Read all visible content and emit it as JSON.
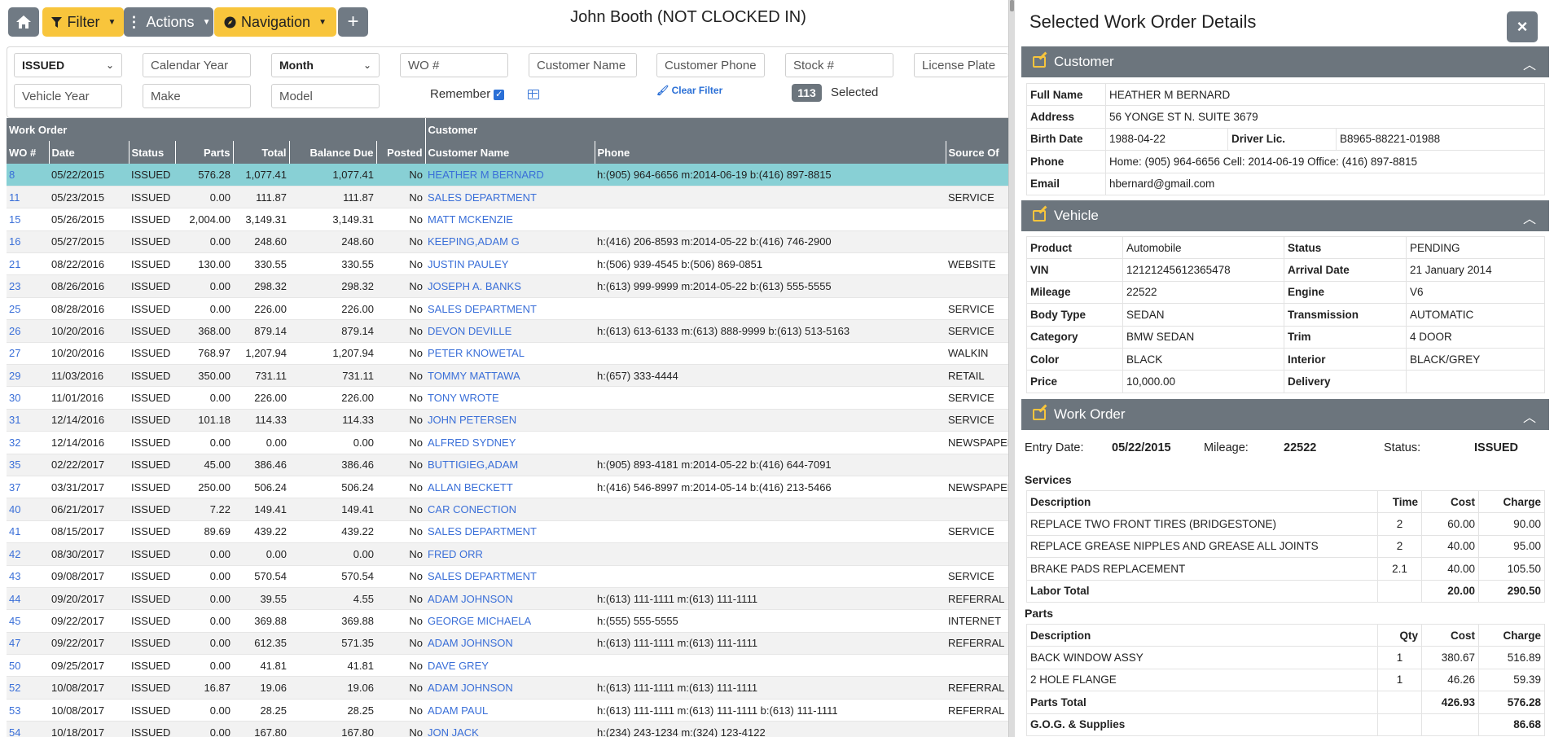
{
  "topbar": {
    "filter_label": "Filter",
    "actions_label": "Actions",
    "navigation_label": "Navigation",
    "user_title": "John Booth (NOT CLOCKED IN)"
  },
  "filters": {
    "status_selected": "ISSUED",
    "calendar_year_placeholder": "Calendar Year",
    "month_selected": "Month",
    "wo_placeholder": "WO #",
    "customer_name_placeholder": "Customer Name",
    "customer_phone_placeholder": "Customer Phone",
    "stock_placeholder": "Stock #",
    "license_plate_placeholder": "License Plate",
    "vehicle_year_placeholder": "Vehicle Year",
    "make_placeholder": "Make",
    "model_placeholder": "Model",
    "remember_label": "Remember",
    "remember_checked": true,
    "clear_filter_label": "Clear Filter",
    "count": "113",
    "selected_label": "Selected"
  },
  "table": {
    "group_headers": {
      "work_order": "Work Order",
      "customer": "Customer"
    },
    "columns": [
      "WO #",
      "Date",
      "Status",
      "Parts",
      "Total",
      "Balance Due",
      "Posted",
      "Customer Name",
      "Phone",
      "Source Of"
    ],
    "rows": [
      {
        "wo": "8",
        "date": "05/22/2015",
        "status": "ISSUED",
        "parts": "576.28",
        "total": "1,077.41",
        "balance": "1,077.41",
        "posted": "No",
        "customer": "HEATHER M BERNARD",
        "phone": "h:(905) 964-6656 m:2014-06-19 b:(416) 897-8815",
        "source": ""
      },
      {
        "wo": "11",
        "date": "05/23/2015",
        "status": "ISSUED",
        "parts": "0.00",
        "total": "111.87",
        "balance": "111.87",
        "posted": "No",
        "customer": "SALES DEPARTMENT",
        "phone": "",
        "source": "SERVICE"
      },
      {
        "wo": "15",
        "date": "05/26/2015",
        "status": "ISSUED",
        "parts": "2,004.00",
        "total": "3,149.31",
        "balance": "3,149.31",
        "posted": "No",
        "customer": "MATT MCKENZIE",
        "phone": "",
        "source": ""
      },
      {
        "wo": "16",
        "date": "05/27/2015",
        "status": "ISSUED",
        "parts": "0.00",
        "total": "248.60",
        "balance": "248.60",
        "posted": "No",
        "customer": "KEEPING,ADAM G",
        "phone": "h:(416) 206-8593 m:2014-05-22 b:(416) 746-2900",
        "source": ""
      },
      {
        "wo": "21",
        "date": "08/22/2016",
        "status": "ISSUED",
        "parts": "130.00",
        "total": "330.55",
        "balance": "330.55",
        "posted": "No",
        "customer": "JUSTIN PAULEY",
        "phone": "h:(506) 939-4545 b:(506) 869-0851",
        "source": "WEBSITE"
      },
      {
        "wo": "23",
        "date": "08/26/2016",
        "status": "ISSUED",
        "parts": "0.00",
        "total": "298.32",
        "balance": "298.32",
        "posted": "No",
        "customer": "JOSEPH A. BANKS",
        "phone": "h:(613) 999-9999 m:2014-05-22 b:(613) 555-5555",
        "source": ""
      },
      {
        "wo": "25",
        "date": "08/28/2016",
        "status": "ISSUED",
        "parts": "0.00",
        "total": "226.00",
        "balance": "226.00",
        "posted": "No",
        "customer": "SALES DEPARTMENT",
        "phone": "",
        "source": "SERVICE"
      },
      {
        "wo": "26",
        "date": "10/20/2016",
        "status": "ISSUED",
        "parts": "368.00",
        "total": "879.14",
        "balance": "879.14",
        "posted": "No",
        "customer": "DEVON DEVILLE",
        "phone": "h:(613) 613-6133 m:(613) 888-9999 b:(613) 513-5163",
        "source": "SERVICE"
      },
      {
        "wo": "27",
        "date": "10/20/2016",
        "status": "ISSUED",
        "parts": "768.97",
        "total": "1,207.94",
        "balance": "1,207.94",
        "posted": "No",
        "customer": "PETER KNOWETAL",
        "phone": "",
        "source": "WALKIN"
      },
      {
        "wo": "29",
        "date": "11/03/2016",
        "status": "ISSUED",
        "parts": "350.00",
        "total": "731.11",
        "balance": "731.11",
        "posted": "No",
        "customer": "TOMMY MATTAWA",
        "phone": "h:(657) 333-4444",
        "source": "RETAIL"
      },
      {
        "wo": "30",
        "date": "11/01/2016",
        "status": "ISSUED",
        "parts": "0.00",
        "total": "226.00",
        "balance": "226.00",
        "posted": "No",
        "customer": "TONY WROTE",
        "phone": "",
        "source": "SERVICE"
      },
      {
        "wo": "31",
        "date": "12/14/2016",
        "status": "ISSUED",
        "parts": "101.18",
        "total": "114.33",
        "balance": "114.33",
        "posted": "No",
        "customer": "JOHN PETERSEN",
        "phone": "",
        "source": "SERVICE"
      },
      {
        "wo": "32",
        "date": "12/14/2016",
        "status": "ISSUED",
        "parts": "0.00",
        "total": "0.00",
        "balance": "0.00",
        "posted": "No",
        "customer": "ALFRED SYDNEY",
        "phone": "",
        "source": "NEWSPAPER"
      },
      {
        "wo": "35",
        "date": "02/22/2017",
        "status": "ISSUED",
        "parts": "45.00",
        "total": "386.46",
        "balance": "386.46",
        "posted": "No",
        "customer": "BUTTIGIEG,ADAM",
        "phone": "h:(905) 893-4181 m:2014-05-22 b:(416) 644-7091",
        "source": ""
      },
      {
        "wo": "37",
        "date": "03/31/2017",
        "status": "ISSUED",
        "parts": "250.00",
        "total": "506.24",
        "balance": "506.24",
        "posted": "No",
        "customer": "ALLAN BECKETT",
        "phone": "h:(416) 546-8997 m:2014-05-14 b:(416) 213-5466",
        "source": "NEWSPAPER"
      },
      {
        "wo": "40",
        "date": "06/21/2017",
        "status": "ISSUED",
        "parts": "7.22",
        "total": "149.41",
        "balance": "149.41",
        "posted": "No",
        "customer": "CAR CONECTION",
        "phone": "",
        "source": ""
      },
      {
        "wo": "41",
        "date": "08/15/2017",
        "status": "ISSUED",
        "parts": "89.69",
        "total": "439.22",
        "balance": "439.22",
        "posted": "No",
        "customer": "SALES DEPARTMENT",
        "phone": "",
        "source": "SERVICE"
      },
      {
        "wo": "42",
        "date": "08/30/2017",
        "status": "ISSUED",
        "parts": "0.00",
        "total": "0.00",
        "balance": "0.00",
        "posted": "No",
        "customer": "FRED ORR",
        "phone": "",
        "source": ""
      },
      {
        "wo": "43",
        "date": "09/08/2017",
        "status": "ISSUED",
        "parts": "0.00",
        "total": "570.54",
        "balance": "570.54",
        "posted": "No",
        "customer": "SALES DEPARTMENT",
        "phone": "",
        "source": "SERVICE"
      },
      {
        "wo": "44",
        "date": "09/20/2017",
        "status": "ISSUED",
        "parts": "0.00",
        "total": "39.55",
        "balance": "4.55",
        "posted": "No",
        "customer": "ADAM JOHNSON",
        "phone": "h:(613) 111-1111 m:(613) 111-1111",
        "source": "REFERRAL"
      },
      {
        "wo": "45",
        "date": "09/22/2017",
        "status": "ISSUED",
        "parts": "0.00",
        "total": "369.88",
        "balance": "369.88",
        "posted": "No",
        "customer": "GEORGE MICHAELA",
        "phone": "h:(555) 555-5555",
        "source": "INTERNET"
      },
      {
        "wo": "47",
        "date": "09/22/2017",
        "status": "ISSUED",
        "parts": "0.00",
        "total": "612.35",
        "balance": "571.35",
        "posted": "No",
        "customer": "ADAM JOHNSON",
        "phone": "h:(613) 111-1111 m:(613) 111-1111",
        "source": "REFERRAL"
      },
      {
        "wo": "50",
        "date": "09/25/2017",
        "status": "ISSUED",
        "parts": "0.00",
        "total": "41.81",
        "balance": "41.81",
        "posted": "No",
        "customer": "DAVE GREY",
        "phone": "",
        "source": ""
      },
      {
        "wo": "52",
        "date": "10/08/2017",
        "status": "ISSUED",
        "parts": "16.87",
        "total": "19.06",
        "balance": "19.06",
        "posted": "No",
        "customer": "ADAM JOHNSON",
        "phone": "h:(613) 111-1111 m:(613) 111-1111",
        "source": "REFERRAL"
      },
      {
        "wo": "53",
        "date": "10/08/2017",
        "status": "ISSUED",
        "parts": "0.00",
        "total": "28.25",
        "balance": "28.25",
        "posted": "No",
        "customer": "ADAM PAUL",
        "phone": "h:(613) 111-1111 m:(613) 111-1111 b:(613) 111-1111",
        "source": "REFERRAL"
      },
      {
        "wo": "54",
        "date": "10/18/2017",
        "status": "ISSUED",
        "parts": "0.00",
        "total": "167.80",
        "balance": "167.80",
        "posted": "No",
        "customer": "JON JACK",
        "phone": "h:(234) 243-1234 m:(324) 123-4122",
        "source": ""
      }
    ]
  },
  "details": {
    "title": "Selected Work Order Details",
    "close_label": "×",
    "customer": {
      "header": "Customer",
      "full_name_label": "Full Name",
      "full_name": "HEATHER M BERNARD",
      "address_label": "Address",
      "address": "56 YONGE ST N. SUITE 3679",
      "birth_label": "Birth Date",
      "birth": "1988-04-22",
      "dl_label": "Driver Lic.",
      "dl": "B8965-88221-01988",
      "phone_label": "Phone",
      "phone": "Home: (905) 964-6656 Cell: 2014-06-19 Office: (416) 897-8815",
      "email_label": "Email",
      "email": "hbernard@gmail.com"
    },
    "vehicle": {
      "header": "Vehicle",
      "rows": [
        {
          "k1": "Product",
          "v1": "Automobile",
          "k2": "Status",
          "v2": "PENDING"
        },
        {
          "k1": "VIN",
          "v1": "12121245612365478",
          "k2": "Arrival Date",
          "v2": "21 January 2014"
        },
        {
          "k1": "Mileage",
          "v1": "22522",
          "k2": "Engine",
          "v2": "V6"
        },
        {
          "k1": "Body Type",
          "v1": "SEDAN",
          "k2": "Transmission",
          "v2": "AUTOMATIC"
        },
        {
          "k1": "Category",
          "v1": "BMW SEDAN",
          "k2": "Trim",
          "v2": "4 DOOR"
        },
        {
          "k1": "Color",
          "v1": "BLACK",
          "k2": "Interior",
          "v2": "BLACK/GREY"
        },
        {
          "k1": "Price",
          "v1": "10,000.00",
          "k2": "Delivery",
          "v2": ""
        }
      ]
    },
    "work_order": {
      "header": "Work Order",
      "entry_label": "Entry Date:",
      "entry": "05/22/2015",
      "mileage_label": "Mileage:",
      "mileage": "22522",
      "status_label": "Status:",
      "status": "ISSUED",
      "services_label": "Services",
      "services_cols": [
        "Description",
        "Time",
        "Cost",
        "Charge"
      ],
      "services": [
        {
          "desc": "REPLACE TWO FRONT TIRES (BRIDGESTONE)",
          "time": "2",
          "cost": "60.00",
          "charge": "90.00"
        },
        {
          "desc": "REPLACE GREASE NIPPLES AND GREASE ALL JOINTS",
          "time": "2",
          "cost": "40.00",
          "charge": "95.00"
        },
        {
          "desc": "BRAKE PADS REPLACEMENT",
          "time": "2.1",
          "cost": "40.00",
          "charge": "105.50"
        }
      ],
      "labor_total_label": "Labor Total",
      "labor_cost": "20.00",
      "labor_charge": "290.50",
      "parts_label": "Parts",
      "parts_cols": [
        "Description",
        "Qty",
        "Cost",
        "Charge"
      ],
      "parts": [
        {
          "desc": "BACK WINDOW ASSY",
          "qty": "1",
          "cost": "380.67",
          "charge": "516.89"
        },
        {
          "desc": "2 HOLE FLANGE",
          "qty": "1",
          "cost": "46.26",
          "charge": "59.39"
        }
      ],
      "parts_total_label": "Parts Total",
      "parts_cost": "426.93",
      "parts_charge": "576.28",
      "gog_label": "G.O.G. & Supplies",
      "gog": "86.68"
    }
  },
  "colors": {
    "accent_yellow": "#f8c53c",
    "header_gray": "#6c757d",
    "link_blue": "#3a6fd8",
    "highlight_row": "#88d0d5"
  }
}
